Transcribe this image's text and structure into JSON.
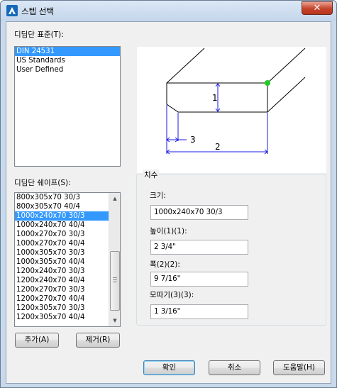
{
  "window": {
    "title": "스텝 선택",
    "close_label": "✕"
  },
  "standards": {
    "label": "디딤단 표준(T):",
    "items": [
      {
        "label": "DIN 24531",
        "selected": true
      },
      {
        "label": "US Standards",
        "selected": false
      },
      {
        "label": "User Defined",
        "selected": false
      }
    ]
  },
  "preview": {
    "labels": {
      "height_num": "1",
      "width_num": "2",
      "chamfer_num": "3"
    },
    "colors": {
      "line": "#000000",
      "dimension": "#1a1ae6",
      "marker": "#22cc22"
    }
  },
  "shapes": {
    "label": "디딤단 쉐이프(S):",
    "items": [
      {
        "label": "800x305x70 30/3",
        "selected": false
      },
      {
        "label": "800x305x70 40/4",
        "selected": false
      },
      {
        "label": "1000x240x70 30/3",
        "selected": true
      },
      {
        "label": "1000x240x70 40/4",
        "selected": false
      },
      {
        "label": "1000x270x70 30/3",
        "selected": false
      },
      {
        "label": "1000x270x70 40/4",
        "selected": false
      },
      {
        "label": "1000x305x70 30/3",
        "selected": false
      },
      {
        "label": "1000x305x70 40/4",
        "selected": false
      },
      {
        "label": "1200x240x70 30/3",
        "selected": false
      },
      {
        "label": "1200x240x70 40/4",
        "selected": false
      },
      {
        "label": "1200x270x70 30/3",
        "selected": false
      },
      {
        "label": "1200x270x70 40/4",
        "selected": false
      },
      {
        "label": "1200x305x70 30/3",
        "selected": false
      },
      {
        "label": "1200x305x70 40/4",
        "selected": false
      }
    ]
  },
  "dimensions": {
    "group_title": "치수",
    "size_label": "크기:",
    "size_value": "1000x240x70 30/3",
    "height_label": "높이(1)(1):",
    "height_value": "2 3/4\"",
    "width_label": "폭(2)(2):",
    "width_value": "9 7/16\"",
    "chamfer_label": "모따기(3)(3):",
    "chamfer_value": "1 3/16\""
  },
  "buttons": {
    "add": "추가(A)",
    "remove": "제거(R)",
    "ok": "확인",
    "cancel": "취소",
    "help": "도움말(H)"
  },
  "colors": {
    "selection": "#3399ff",
    "dialog_bg": "#f0f0f0",
    "frame": "#c9d9ec"
  }
}
